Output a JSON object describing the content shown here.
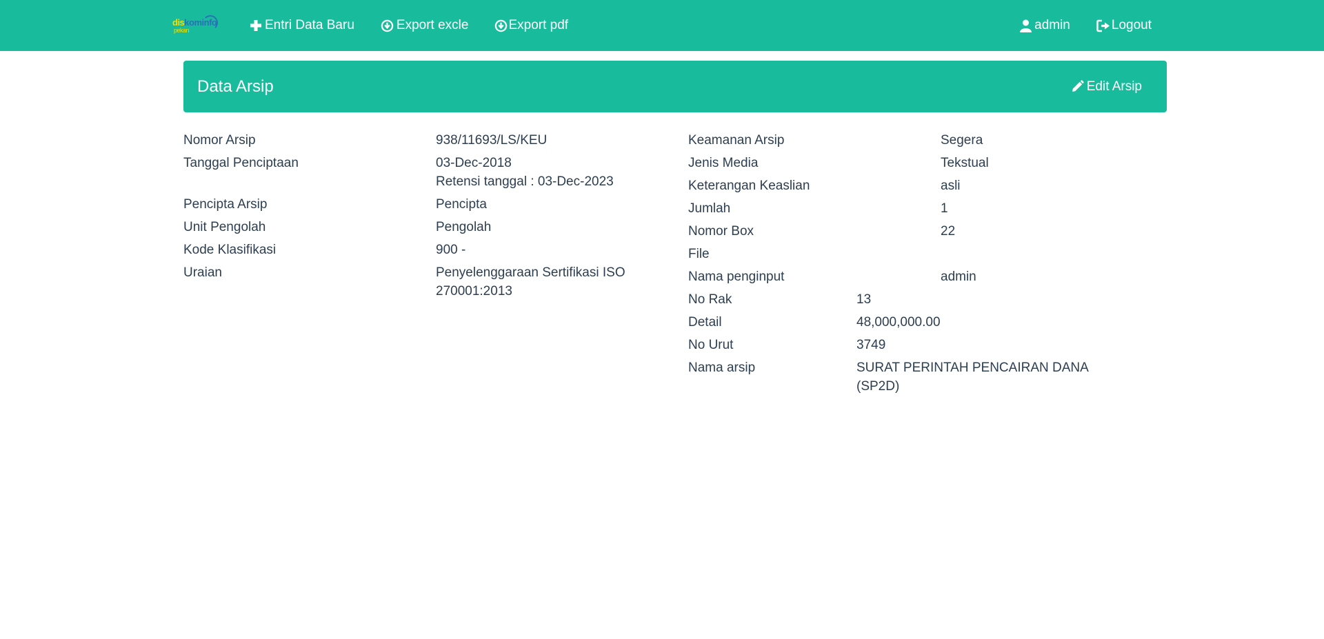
{
  "navbar": {
    "logo": {
      "line1_a": "dis",
      "line1_b": "kominfo",
      "line2": "pekan"
    },
    "links": [
      {
        "icon": "plus-icon",
        "label": "Entri Data Baru"
      },
      {
        "icon": "download-circle-icon",
        "label": "Export excle"
      },
      {
        "icon": "download-circle-icon",
        "label": "Export pdf"
      }
    ],
    "user_label": "admin",
    "logout_label": "Logout"
  },
  "panel": {
    "title": "Data Arsip",
    "edit_label": "Edit Arsip"
  },
  "details_left": [
    {
      "key": "Nomor Arsip",
      "value": "938/11693/LS/KEU"
    },
    {
      "key": "Tanggal Penciptaan",
      "value": "03-Dec-2018",
      "value2": "Retensi tanggal : 03-Dec-2023"
    },
    {
      "key": "Pencipta Arsip",
      "value": "Pencipta"
    },
    {
      "key": "Unit Pengolah",
      "value": "Pengolah"
    },
    {
      "key": "Kode Klasifikasi",
      "value": "900 -"
    },
    {
      "key": "Uraian",
      "value": "Penyelenggaraan Sertifikasi ISO 270001:2013"
    }
  ],
  "details_right": [
    {
      "key": "Keamanan Arsip",
      "value": "Segera"
    },
    {
      "key": "Jenis Media",
      "value": "Tekstual"
    },
    {
      "key": "Keterangan Keaslian",
      "value": "asli"
    },
    {
      "key": "Jumlah",
      "value": "1"
    },
    {
      "key": "Nomor Box",
      "value": "22"
    },
    {
      "key": "File",
      "value": ""
    },
    {
      "key": "Nama penginput",
      "value": "admin"
    },
    {
      "key": "No Rak",
      "value": "13"
    },
    {
      "key": "Detail",
      "value": "48,000,000.00"
    },
    {
      "key": "No Urut",
      "value": "3749"
    },
    {
      "key": "Nama arsip",
      "value": "SURAT PERINTAH PENCAIRAN DANA (SP2D)"
    }
  ]
}
